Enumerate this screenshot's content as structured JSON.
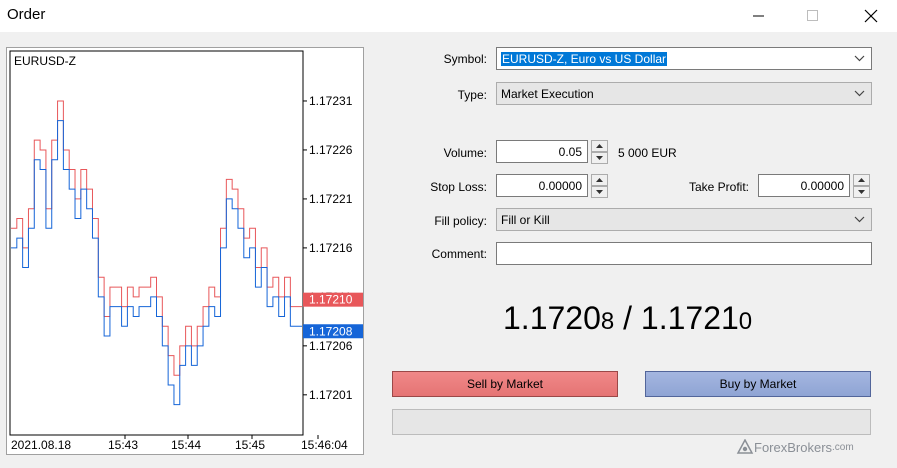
{
  "window": {
    "title": "Order"
  },
  "chart": {
    "symbol_label": "EURUSD-Z",
    "date_label": "2021.08.18",
    "time_labels": [
      "15:43",
      "15:44",
      "15:45",
      "15:46:04"
    ],
    "price_ticks": [
      "1.17231",
      "1.17226",
      "1.17221",
      "1.17216",
      "1.17211",
      "1.17206",
      "1.17201"
    ],
    "ask_badge": "1.17210",
    "bid_badge": "1.17208",
    "ask_color": "#e8575a",
    "bid_color": "#1565d8"
  },
  "chart_data": {
    "type": "line",
    "title": "EURUSD-Z",
    "xlabel": "",
    "ylabel": "",
    "x_ticks": [
      "2021.08.18",
      "15:43",
      "15:44",
      "15:45",
      "15:46:04"
    ],
    "y_ticks": [
      1.17231,
      1.17226,
      1.17221,
      1.17216,
      1.17211,
      1.17206,
      1.17201
    ],
    "ylim": [
      1.17197,
      1.17236
    ],
    "grid": false,
    "legend": "none",
    "series": [
      {
        "name": "",
        "color": "#e8575a",
        "x": [
          0,
          0.02,
          0.04,
          0.06,
          0.08,
          0.1,
          0.12,
          0.14,
          0.16,
          0.18,
          0.2,
          0.22,
          0.24,
          0.26,
          0.28,
          0.3,
          0.32,
          0.34,
          0.36,
          0.38,
          0.4,
          0.42,
          0.44,
          0.46,
          0.48,
          0.5,
          0.52,
          0.54,
          0.56,
          0.58,
          0.6,
          0.62,
          0.64,
          0.66,
          0.68,
          0.7,
          0.72,
          0.74,
          0.76,
          0.78,
          0.8,
          0.82,
          0.84,
          0.86,
          0.88,
          0.9,
          0.92,
          0.94,
          0.96,
          0.98,
          1.0
        ],
        "values": [
          1.17218,
          1.17219,
          1.17216,
          1.1722,
          1.17227,
          1.17226,
          1.1722,
          1.17227,
          1.17231,
          1.17226,
          1.17224,
          1.17221,
          1.17224,
          1.17222,
          1.17219,
          1.17213,
          1.17209,
          1.17212,
          1.17212,
          1.1721,
          1.17212,
          1.17211,
          1.17212,
          1.17212,
          1.17213,
          1.17211,
          1.17208,
          1.17205,
          1.17203,
          1.17206,
          1.17208,
          1.17206,
          1.17208,
          1.1721,
          1.17212,
          1.17211,
          1.17218,
          1.17223,
          1.17222,
          1.1722,
          1.17217,
          1.17218,
          1.17214,
          1.17216,
          1.17212,
          1.17213,
          1.17211,
          1.17213,
          1.1721,
          1.1721,
          1.1721
        ]
      },
      {
        "name": "",
        "color": "#1565d8",
        "x": [
          0,
          0.02,
          0.04,
          0.06,
          0.08,
          0.1,
          0.12,
          0.14,
          0.16,
          0.18,
          0.2,
          0.22,
          0.24,
          0.26,
          0.28,
          0.3,
          0.32,
          0.34,
          0.36,
          0.38,
          0.4,
          0.42,
          0.44,
          0.46,
          0.48,
          0.5,
          0.52,
          0.54,
          0.56,
          0.58,
          0.6,
          0.62,
          0.64,
          0.66,
          0.68,
          0.7,
          0.72,
          0.74,
          0.76,
          0.78,
          0.8,
          0.82,
          0.84,
          0.86,
          0.88,
          0.9,
          0.92,
          0.94,
          0.96,
          0.98,
          1.0
        ],
        "values": [
          1.17216,
          1.17217,
          1.17214,
          1.17218,
          1.17225,
          1.17224,
          1.17218,
          1.17225,
          1.17229,
          1.17224,
          1.17222,
          1.17219,
          1.17222,
          1.1722,
          1.17217,
          1.17211,
          1.17207,
          1.1721,
          1.1721,
          1.17208,
          1.1721,
          1.17209,
          1.1721,
          1.1721,
          1.17211,
          1.17209,
          1.17206,
          1.17202,
          1.172,
          1.17204,
          1.17206,
          1.17204,
          1.17206,
          1.17208,
          1.1721,
          1.17209,
          1.17216,
          1.17221,
          1.1722,
          1.17218,
          1.17215,
          1.17216,
          1.17212,
          1.17214,
          1.1721,
          1.17211,
          1.17209,
          1.17211,
          1.17208,
          1.17208,
          1.17208
        ]
      }
    ]
  },
  "form": {
    "symbol": {
      "label": "Symbol:",
      "value": "EURUSD-Z, Euro vs US Dollar"
    },
    "type": {
      "label": "Type:",
      "value": "Market Execution"
    },
    "volume": {
      "label": "Volume:",
      "value": "0.05",
      "note": "5 000 EUR"
    },
    "stop_loss": {
      "label": "Stop Loss:",
      "value": "0.00000"
    },
    "take_profit": {
      "label": "Take Profit:",
      "value": "0.00000"
    },
    "fill_policy": {
      "label": "Fill policy:",
      "value": "Fill or Kill"
    },
    "comment": {
      "label": "Comment:",
      "value": ""
    }
  },
  "quote": {
    "bid_main": "1.1720",
    "bid_small": "8",
    "separator": "/",
    "ask_main": "1.1721",
    "ask_small": "0"
  },
  "actions": {
    "sell_label": "Sell by Market",
    "buy_label": "Buy by Market",
    "progress": 0
  },
  "watermark": {
    "text": "ForexBrokers",
    "suffix": ".com"
  }
}
